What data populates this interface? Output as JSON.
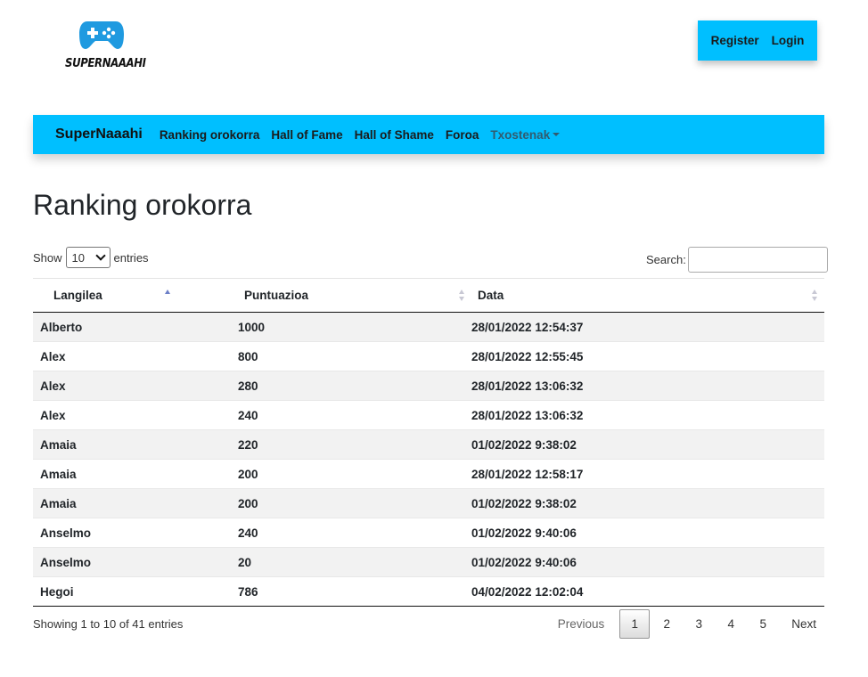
{
  "logo": {
    "text": "SUPERNAAAHI",
    "icon": "gamepad-icon",
    "color": "#1f9ae0"
  },
  "auth": {
    "register": "Register",
    "login": "Login"
  },
  "nav": {
    "brand": "SuperNaaahi",
    "links": [
      "Ranking orokorra",
      "Hall of Fame",
      "Hall of Shame",
      "Foroa"
    ],
    "dropdown": "Txostenak"
  },
  "page": {
    "title": "Ranking orokorra"
  },
  "controls": {
    "show_label": "Show",
    "entries_value": "10",
    "entries_label": "entries",
    "search_label": "Search:",
    "search_value": ""
  },
  "table": {
    "columns": [
      "Langilea",
      "Puntuazioa",
      "Data"
    ],
    "sort_column": "Langilea",
    "rows": [
      [
        "Alberto",
        "1000",
        "28/01/2022 12:54:37"
      ],
      [
        "Alex",
        "800",
        "28/01/2022 12:55:45"
      ],
      [
        "Alex",
        "280",
        "28/01/2022 13:06:32"
      ],
      [
        "Alex",
        "240",
        "28/01/2022 13:06:32"
      ],
      [
        "Amaia",
        "220",
        "01/02/2022 9:38:02"
      ],
      [
        "Amaia",
        "200",
        "28/01/2022 12:58:17"
      ],
      [
        "Amaia",
        "200",
        "01/02/2022 9:38:02"
      ],
      [
        "Anselmo",
        "240",
        "01/02/2022 9:40:06"
      ],
      [
        "Anselmo",
        "20",
        "01/02/2022 9:40:06"
      ],
      [
        "Hegoi",
        "786",
        "04/02/2022 12:02:04"
      ]
    ]
  },
  "footer": {
    "info": "Showing 1 to 10 of 41 entries",
    "previous": "Previous",
    "pages": [
      "1",
      "2",
      "3",
      "4",
      "5"
    ],
    "current_page": "1",
    "next": "Next"
  },
  "colors": {
    "accent": "#00bfff"
  }
}
